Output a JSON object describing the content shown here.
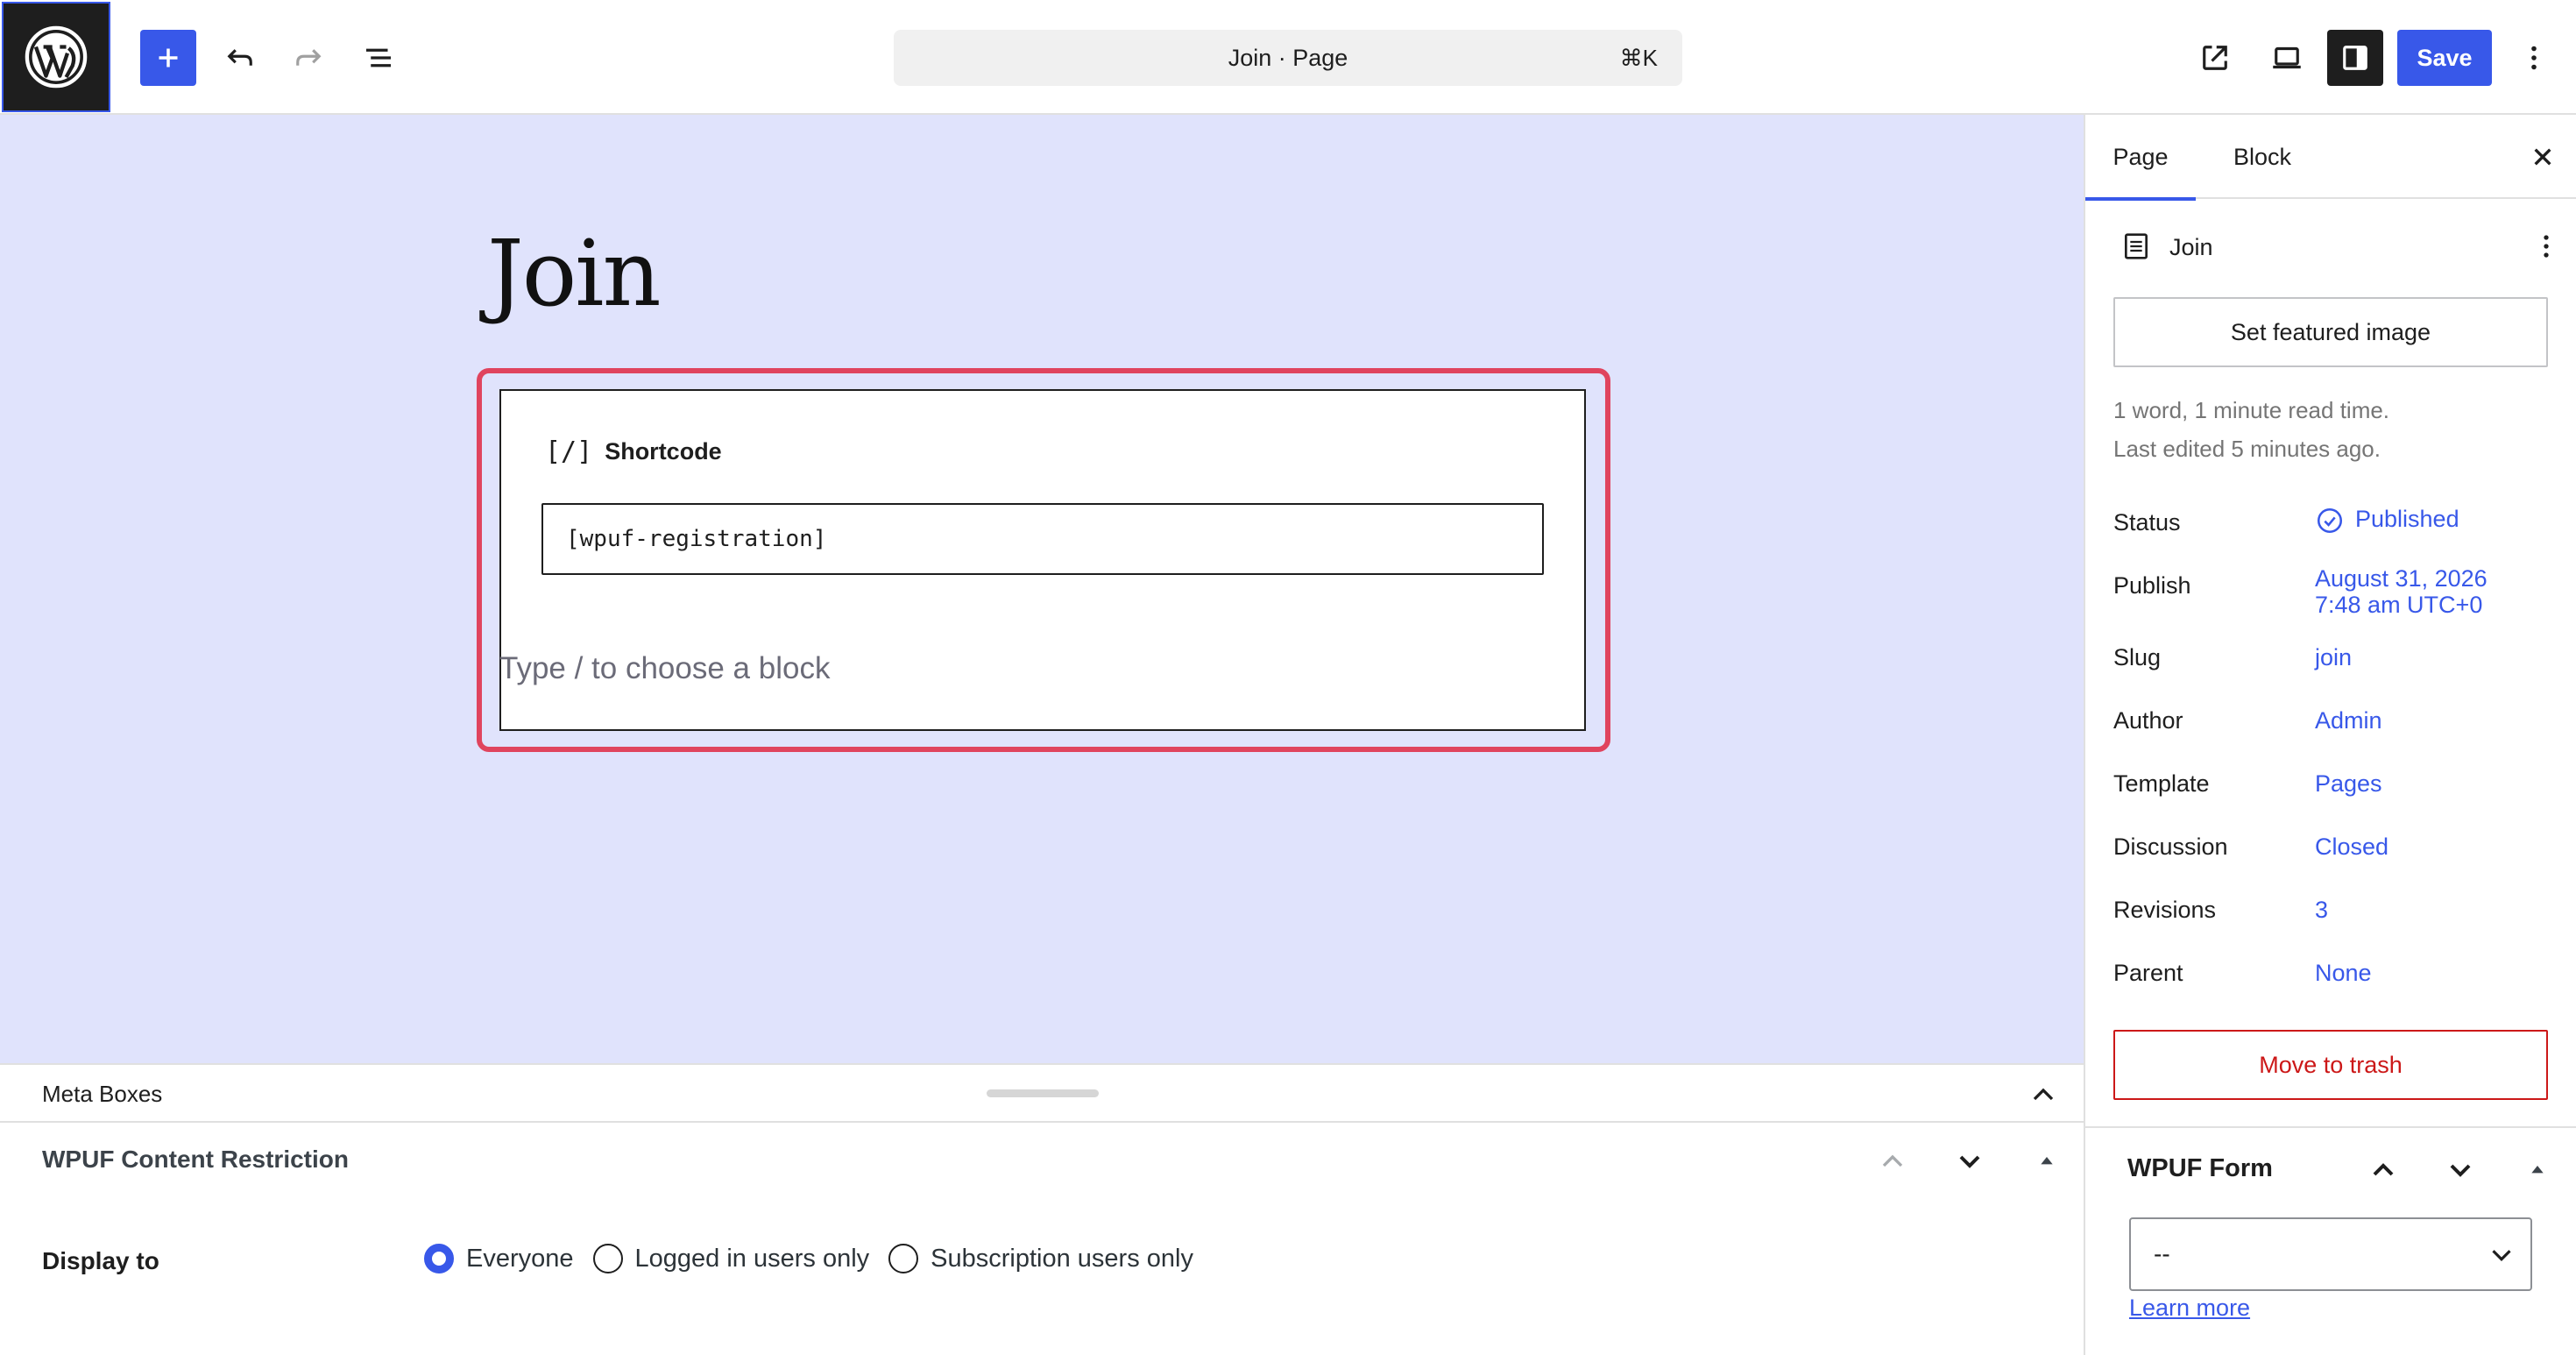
{
  "topbar": {
    "document_title": "Join · Page",
    "shortcut": "⌘K",
    "save_label": "Save",
    "accent_color": "#3858e9",
    "icons": [
      "wordpress-logo-icon",
      "plus-icon",
      "undo-icon",
      "redo-icon",
      "list-view-icon",
      "external-link-icon",
      "laptop-preview-icon",
      "sidebar-settings-icon",
      "more-vertical-icon"
    ]
  },
  "canvas": {
    "page_title": "Join",
    "background_color": "#e0e3fc",
    "shortcode_block": {
      "icon": "[/]",
      "label": "Shortcode",
      "value": "[wpuf-registration]",
      "highlight_color": "#e0445e"
    },
    "appender_text": "Type / to choose a block"
  },
  "meta_boxes": {
    "title": "Meta Boxes",
    "panel_title": "WPUF Content Restriction",
    "display_to_label": "Display to",
    "options": [
      {
        "label": "Everyone",
        "checked": true
      },
      {
        "label": "Logged in users only",
        "checked": false
      },
      {
        "label": "Subscription users only",
        "checked": false
      }
    ]
  },
  "sidebar": {
    "tabs": [
      {
        "label": "Page",
        "active": true
      },
      {
        "label": "Block",
        "active": false
      }
    ],
    "document": {
      "title": "Join"
    },
    "featured_image_label": "Set featured image",
    "word_count": "1 word, 1 minute read time.",
    "last_edited": "Last edited 5 minutes ago.",
    "rows": {
      "status": {
        "label": "Status",
        "value": "Published"
      },
      "publish": {
        "label": "Publish",
        "value_line1": "August 31, 2026",
        "value_line2": "7:48 am UTC+0"
      },
      "slug": {
        "label": "Slug",
        "value": "join"
      },
      "author": {
        "label": "Author",
        "value": "Admin"
      },
      "template": {
        "label": "Template",
        "value": "Pages"
      },
      "discussion": {
        "label": "Discussion",
        "value": "Closed"
      },
      "revisions": {
        "label": "Revisions",
        "value": "3"
      },
      "parent": {
        "label": "Parent",
        "value": "None"
      }
    },
    "trash_label": "Move to trash",
    "trash_color": "#cc1818",
    "wpuf_form": {
      "title": "WPUF Form",
      "selected": "--",
      "learn_more": "Learn more"
    }
  }
}
